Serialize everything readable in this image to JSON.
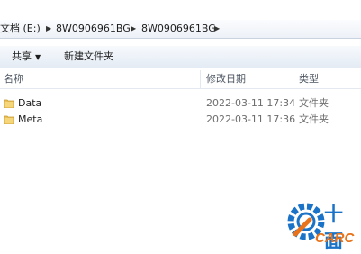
{
  "address": {
    "segments": [
      "文档 (E:)",
      "8W0906961BG",
      "8W0906961BG"
    ]
  },
  "toolbar": {
    "share_label": "共享",
    "new_folder_label": "新建文件夹"
  },
  "columns": {
    "name": "名称",
    "date": "修改日期",
    "type": "类型"
  },
  "files": [
    {
      "name": "Data",
      "date": "2022-03-11 17:34",
      "type": "文件夹",
      "icon": "folder-icon"
    },
    {
      "name": "Meta",
      "date": "2022-03-11 17:36",
      "type": "文件夹",
      "icon": "folder-icon"
    }
  ],
  "watermark": {
    "cn_text": "十面",
    "logo_text": "CARC"
  },
  "colors": {
    "folder": "#e9c15a",
    "watermark_blue": "#1a73c7",
    "watermark_orange": "#e8731a"
  }
}
